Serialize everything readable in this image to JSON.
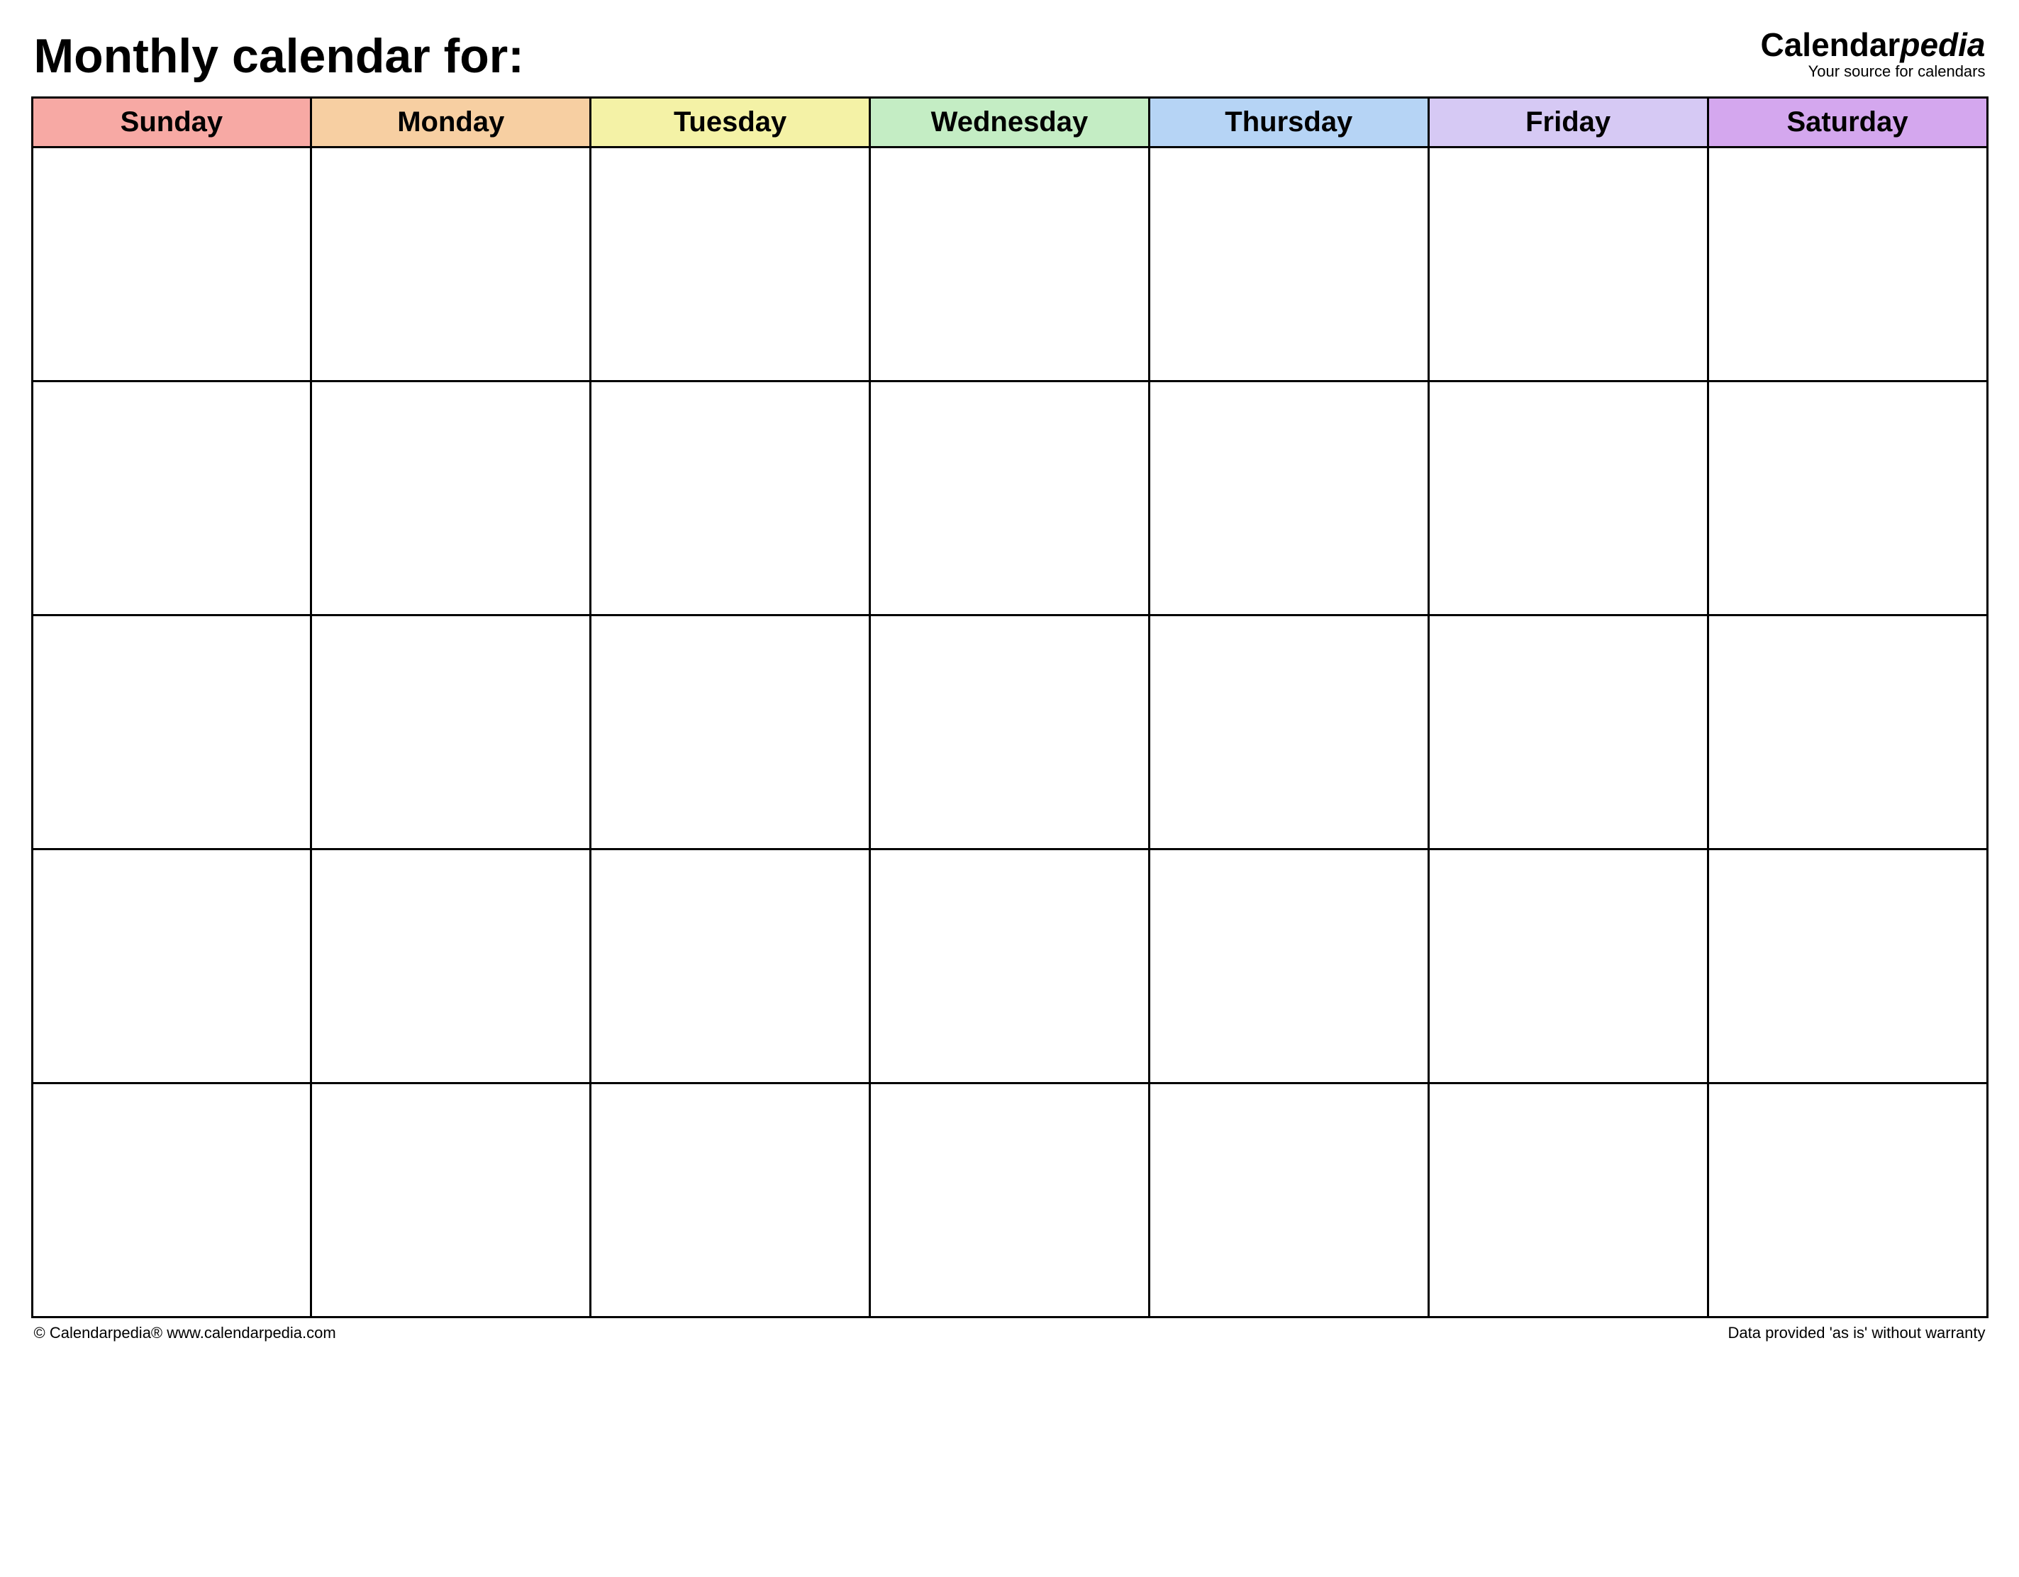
{
  "title": "Monthly calendar for:",
  "brand": {
    "part1": "Calendar",
    "part2": "pedia",
    "tagline": "Your source for calendars"
  },
  "days": [
    {
      "label": "Sunday",
      "color": "#f7a9a4"
    },
    {
      "label": "Monday",
      "color": "#f7cfa2"
    },
    {
      "label": "Tuesday",
      "color": "#f4f2a6"
    },
    {
      "label": "Wednesday",
      "color": "#c4edc4"
    },
    {
      "label": "Thursday",
      "color": "#b6d4f5"
    },
    {
      "label": "Friday",
      "color": "#d6c9f4"
    },
    {
      "label": "Saturday",
      "color": "#d4a7ee"
    }
  ],
  "weeks": 5,
  "footer": {
    "left": "© Calendarpedia®   www.calendarpedia.com",
    "right": "Data provided 'as is' without warranty"
  }
}
